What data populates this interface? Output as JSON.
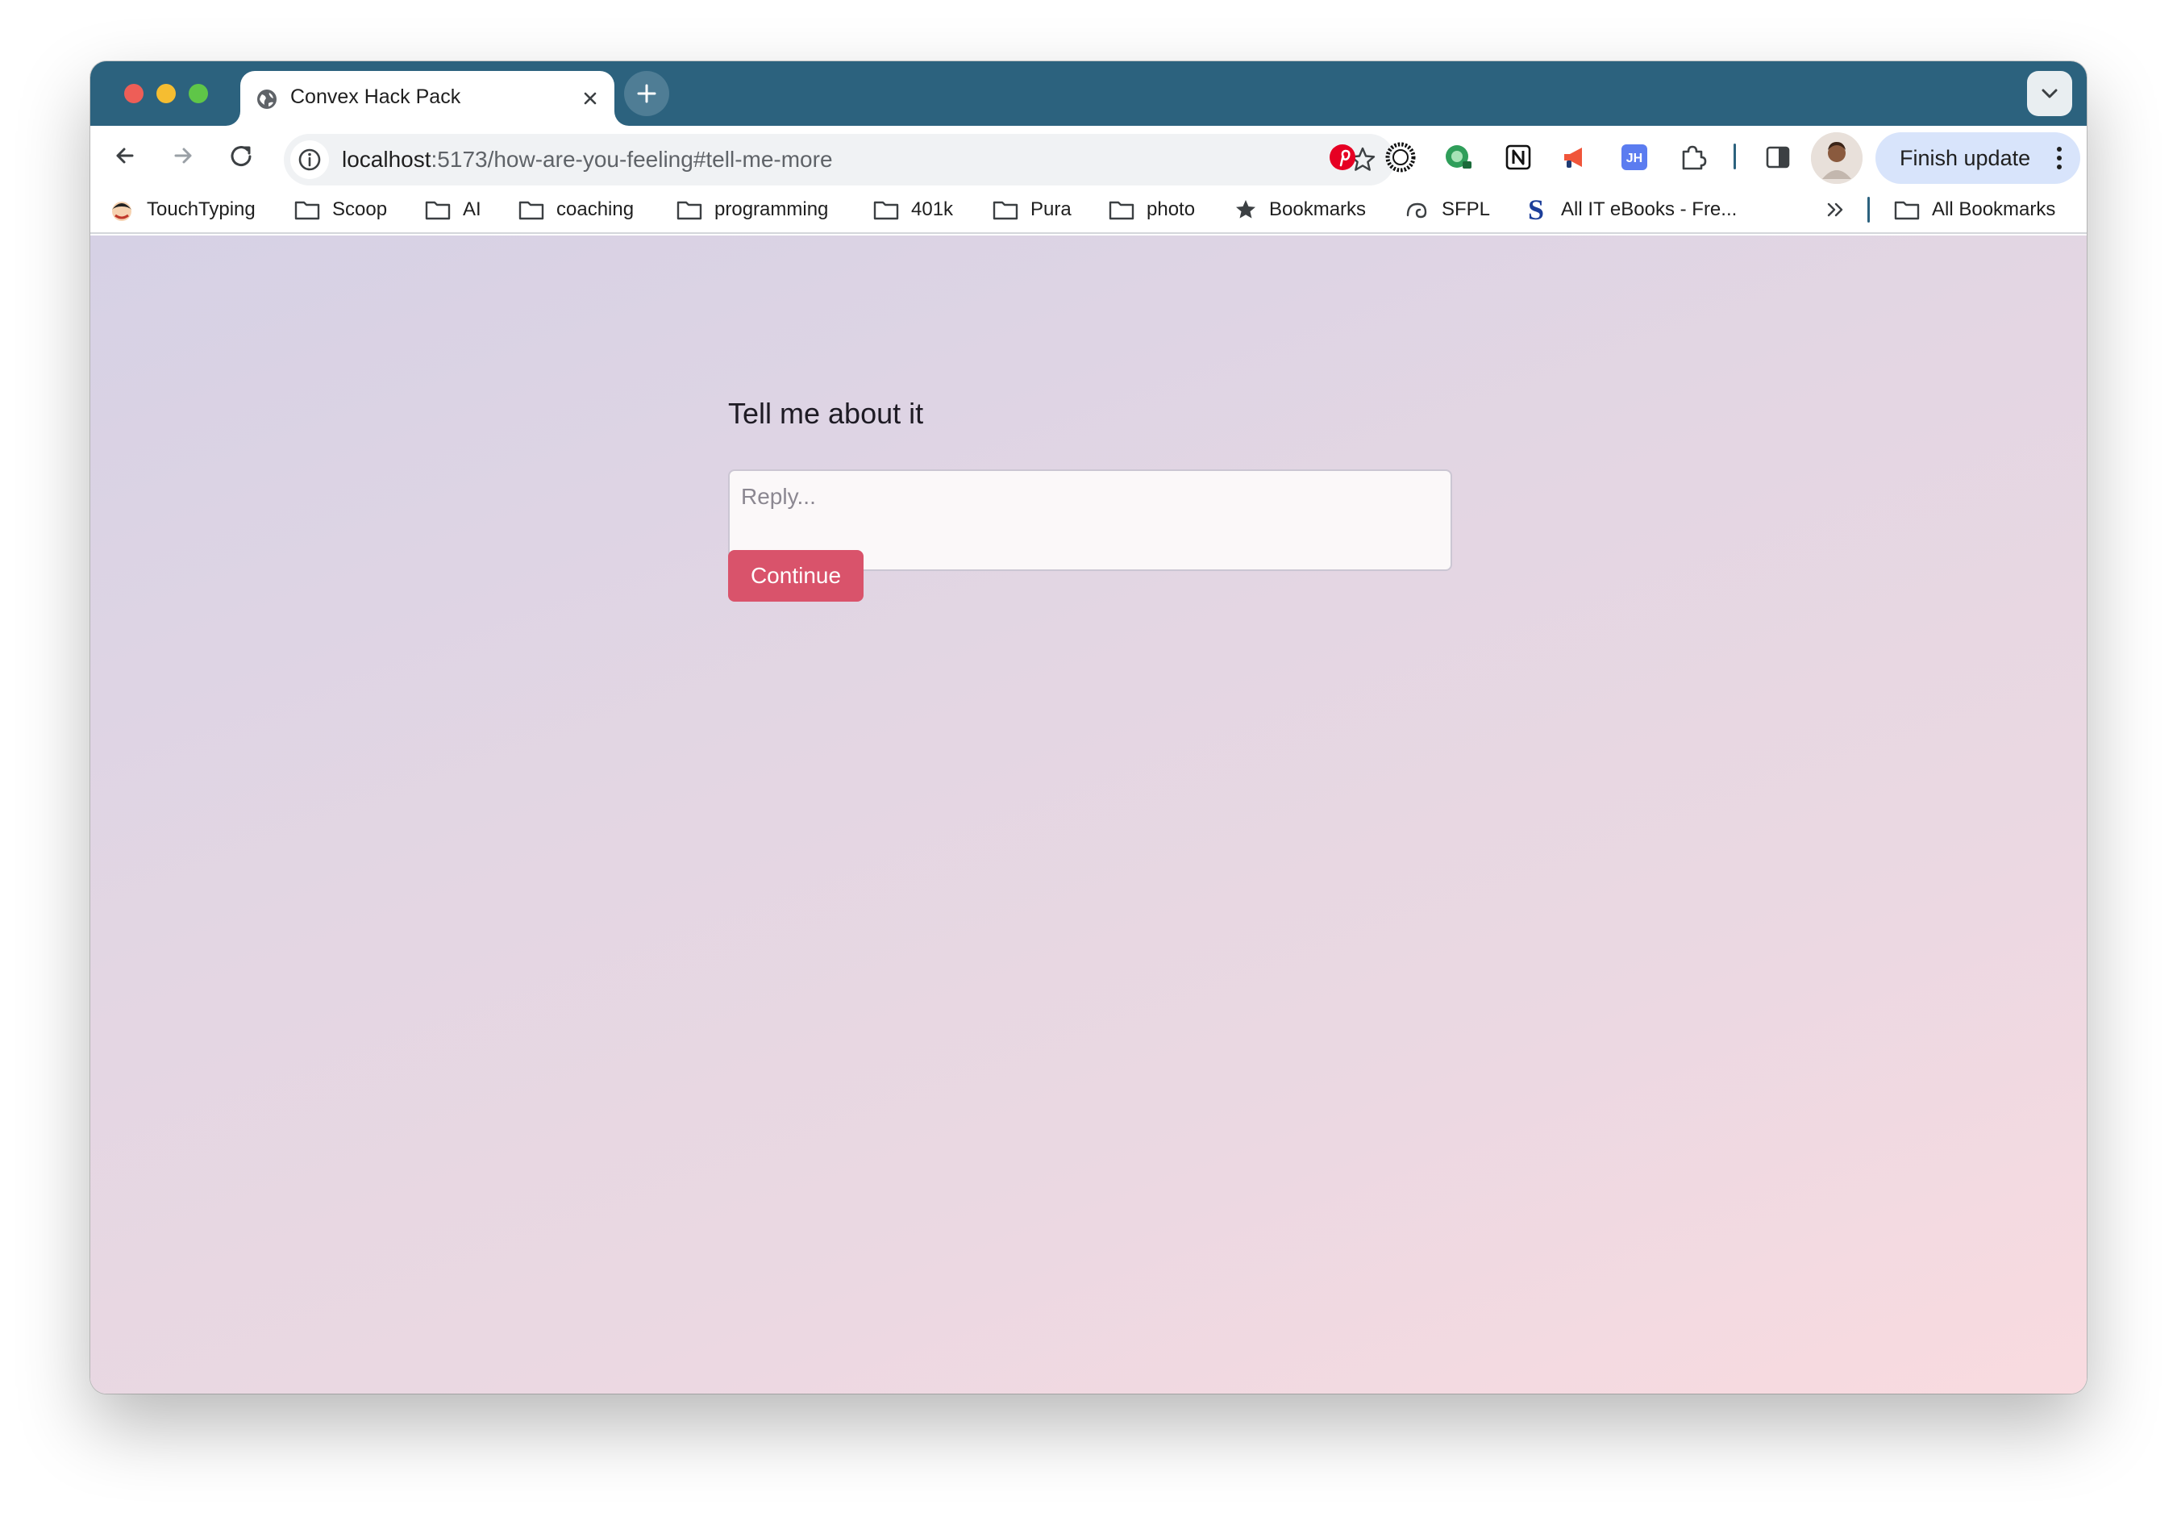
{
  "browser": {
    "tab": {
      "title": "Convex Hack Pack"
    },
    "url": {
      "host": "localhost",
      "path": ":5173/how-are-you-feeling#tell-me-more"
    },
    "finish_update_label": "Finish update",
    "extensions": [
      "pinterest-icon",
      "sunburst-icon",
      "green-extension-icon",
      "notion-icon",
      "megaphone-icon",
      "jh-icon",
      "puzzle-icon"
    ]
  },
  "bookmarks": {
    "items": [
      {
        "label": "TouchTyping",
        "icon": "touchtyping-icon"
      },
      {
        "label": "Scoop",
        "icon": "folder-icon"
      },
      {
        "label": "AI",
        "icon": "folder-icon"
      },
      {
        "label": "coaching",
        "icon": "folder-icon"
      },
      {
        "label": "programming",
        "icon": "folder-icon"
      },
      {
        "label": "401k",
        "icon": "folder-icon"
      },
      {
        "label": "Pura",
        "icon": "folder-icon"
      },
      {
        "label": "photo",
        "icon": "folder-icon"
      },
      {
        "label": "Bookmarks",
        "icon": "star-icon"
      },
      {
        "label": "SFPL",
        "icon": "sfpl-icon"
      },
      {
        "label": "All IT eBooks - Fre...",
        "icon": "s-logo-icon"
      }
    ],
    "all_bookmarks_label": "All Bookmarks"
  },
  "page": {
    "heading": "Tell me about it",
    "reply": {
      "placeholder": "Reply...",
      "value": ""
    },
    "continue_label": "Continue"
  },
  "colors": {
    "tab_strip": "#2c627e",
    "button": "#d9536b",
    "finish_update_bg": "#d8e4fb"
  }
}
